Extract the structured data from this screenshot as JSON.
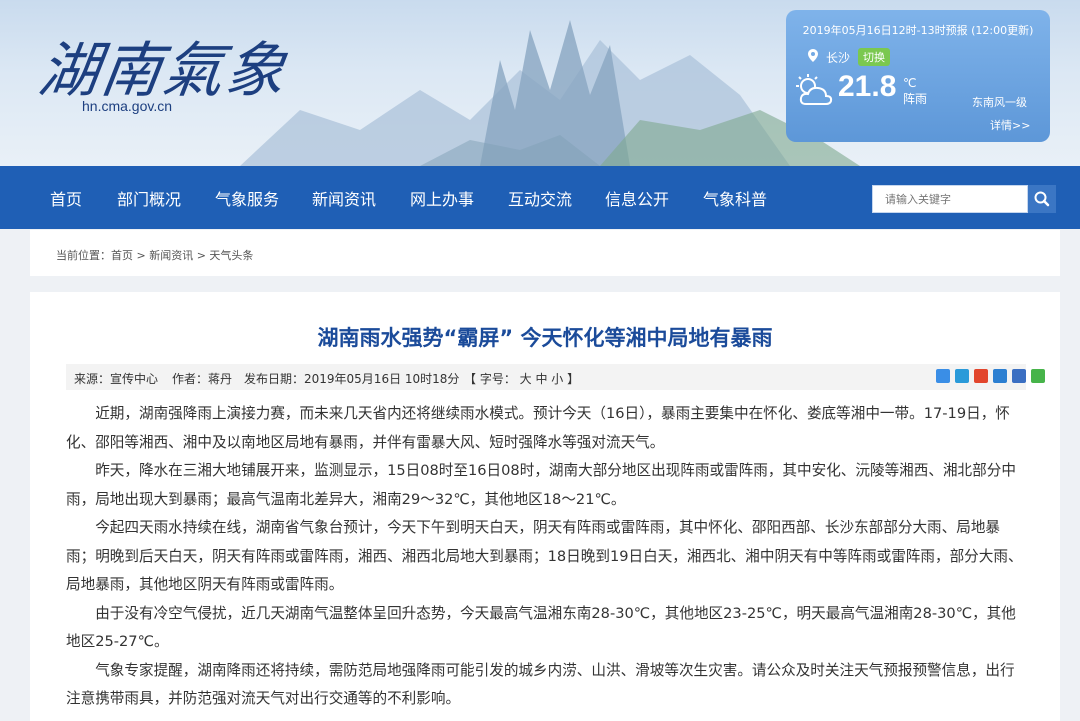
{
  "site": {
    "logo_text": "湖南氣象",
    "domain": "hn.cma.gov.cn"
  },
  "weather": {
    "header": "2019年05月16日12时-13时预报 (12:00更新)",
    "city": "长沙",
    "switch_label": "切换",
    "temperature": "21.8",
    "unit": "℃",
    "condition": "阵雨",
    "wind": "东南风一级",
    "more": "详情>>"
  },
  "nav": {
    "items": [
      "首页",
      "部门概况",
      "气象服务",
      "新闻资讯",
      "网上办事",
      "互动交流",
      "信息公开",
      "气象科普"
    ],
    "search_placeholder": "请输入关键字"
  },
  "breadcrumb": "当前位置：首页 > 新闻资讯 > 天气头条",
  "article": {
    "title": "湖南雨水强势“霸屏” 今天怀化等湘中局地有暴雨",
    "source": "来源：宣传中心",
    "author": "作者：蒋丹",
    "date": "发布日期：2019年05月16日 10时18分",
    "fontsize": "【 字号： 大 中 小 】",
    "paragraphs": [
      "近期，湖南强降雨上演接力赛，而未来几天省内还将继续雨水模式。预计今天（16日），暴雨主要集中在怀化、娄底等湘中一带。17-19日，怀化、邵阳等湘西、湘中及以南地区局地有暴雨，并伴有雷暴大风、短时强降水等强对流天气。",
      "昨天，降水在三湘大地铺展开来，监测显示，15日08时至16日08时，湖南大部分地区出现阵雨或雷阵雨，其中安化、沅陵等湘西、湘北部分中雨，局地出现大到暴雨；最高气温南北差异大，湘南29～32℃，其他地区18～21℃。",
      "今起四天雨水持续在线，湖南省气象台预计，今天下午到明天白天，阴天有阵雨或雷阵雨，其中怀化、邵阳西部、长沙东部部分大雨、局地暴雨；明晚到后天白天，阴天有阵雨或雷阵雨，湘西、湘西北局地大到暴雨；18日晚到19日白天，湘西北、湘中阴天有中等阵雨或雷阵雨，部分大雨、局地暴雨，其他地区阴天有阵雨或雷阵雨。",
      "由于没有冷空气侵扰，近几天湖南气温整体呈回升态势，今天最高气温湘东南28-30℃，其他地区23-25℃，明天最高气温湘南28-30℃，其他地区25-27℃。",
      "气象专家提醒，湖南降雨还将持续，需防范局地强降雨可能引发的城乡内涝、山洪、滑坡等次生灾害。请公众及时关注天气预报预警信息，出行注意携带雨具，并防范强对流天气对出行交通等的不利影响。"
    ]
  },
  "colors": {
    "nav": "#1f5fb5",
    "title": "#1b4b9a",
    "weather_card": "#6fa6e2",
    "switch": "#7bc850"
  }
}
